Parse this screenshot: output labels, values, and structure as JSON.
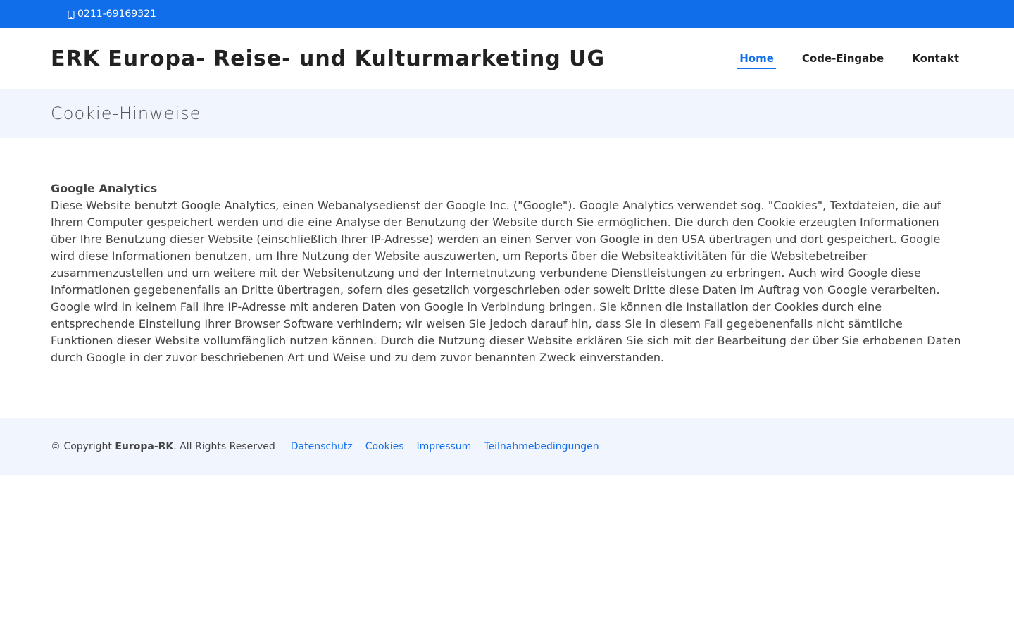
{
  "topbar": {
    "phone": "0211-69169321",
    "phone_icon": "phone-icon"
  },
  "header": {
    "logo": "ERK Europa- Reise- und Kulturmarketing UG",
    "nav": [
      {
        "label": "Home",
        "active": true
      },
      {
        "label": "Code-Eingabe",
        "active": false
      },
      {
        "label": "Kontakt",
        "active": false
      }
    ]
  },
  "breadcrumbs": {
    "title": "Cookie-Hinweise"
  },
  "content": {
    "heading": "Google Analytics",
    "body": "Diese Website benutzt Google Analytics, einen Webanalysedienst der Google Inc. (\"Google\"). Google Analytics verwendet sog. \"Cookies\", Textdateien, die auf Ihrem Computer gespeichert werden und die eine Analyse der Benutzung der Website durch Sie ermöglichen. Die durch den Cookie erzeugten Informationen über Ihre Benutzung dieser Website (einschließlich Ihrer IP-Adresse) werden an einen Server von Google in den USA übertragen und dort gespeichert. Google wird diese Informationen benutzen, um Ihre Nutzung der Website auszuwerten, um Reports über die Websiteaktivitäten für die Websitebetreiber zusammenzustellen und um weitere mit der Websitenutzung und der Internetnutzung verbundene Dienstleistungen zu erbringen. Auch wird Google diese Informationen gegebenenfalls an Dritte übertragen, sofern dies gesetzlich vorgeschrieben oder soweit Dritte diese Daten im Auftrag von Google verarbeiten. Google wird in keinem Fall Ihre IP-Adresse mit anderen Daten von Google in Verbindung bringen. Sie können die Installation der Cookies durch eine entsprechende Einstellung Ihrer Browser Software verhindern; wir weisen Sie jedoch darauf hin, dass Sie in diesem Fall gegebenenfalls nicht sämtliche Funktionen dieser Website vollumfänglich nutzen können. Durch die Nutzung dieser Website erklären Sie sich mit der Bearbeitung der über Sie erhobenen Daten durch Google in der zuvor beschriebenen Art und Weise und zu dem zuvor benannten Zweck einverstanden."
  },
  "footer": {
    "copyright_prefix": "© Copyright ",
    "brand": "Europa-RK",
    "copyright_suffix": ". All Rights Reserved",
    "links": [
      "Datenschutz",
      "Cookies",
      "Impressum",
      "Teilnahmebedingungen"
    ]
  },
  "colors": {
    "accent": "#106eea",
    "light_bg": "#f1f6fe",
    "text": "#444444",
    "heading": "#222222"
  }
}
